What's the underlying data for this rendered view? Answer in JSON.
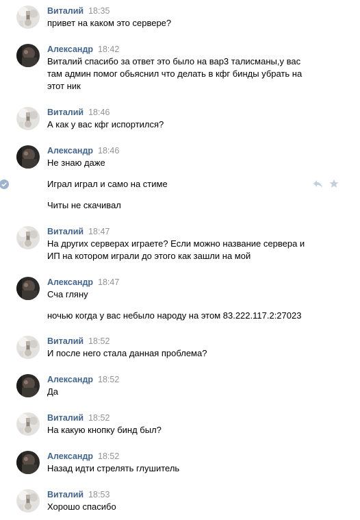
{
  "chat": {
    "messages": [
      {
        "author": "Виталий",
        "time": "18:35",
        "avatar": "vitaly-avatar",
        "lines": [
          "привет на каком это сервере?"
        ]
      },
      {
        "author": "Александр",
        "time": "18:42",
        "avatar": "alexander-avatar",
        "lines": [
          "Виталий спасибо за ответ это было на вар3 талисманы,у вас",
          "там админ помог обьяснил что делать в кфг бинды убрать на",
          "этот ник"
        ]
      },
      {
        "author": "Виталий",
        "time": "18:46",
        "avatar": "vitaly-avatar",
        "lines": [
          "А как у вас кфг испортился?"
        ]
      },
      {
        "author": "Александр",
        "time": "18:46",
        "avatar": "alexander-avatar",
        "lines": [
          "Не знаю даже",
          "Играл играл и само на стиме",
          "Читы не скачивал"
        ]
      },
      {
        "author": "Виталий",
        "time": "18:47",
        "avatar": "vitaly-avatar",
        "lines": [
          "На других серверах играете? Если можно название сервера и",
          "ИП на котором играли до этого как зашли на мой"
        ]
      },
      {
        "author": "Александр",
        "time": "18:47",
        "avatar": "alexander-avatar",
        "lines": [
          "Сча гляну",
          "ночью когда у вас небыло народу на этом 83.222.117.2:27023"
        ]
      },
      {
        "author": "Виталий",
        "time": "18:52",
        "avatar": "vitaly-avatar",
        "lines": [
          "И после него стала данная проблема?"
        ]
      },
      {
        "author": "Александр",
        "time": "18:52",
        "avatar": "alexander-avatar",
        "lines": [
          "Да"
        ]
      },
      {
        "author": "Виталий",
        "time": "18:52",
        "avatar": "vitaly-avatar",
        "lines": [
          "На какую кнопку бинд был?"
        ]
      },
      {
        "author": "Александр",
        "time": "18:52",
        "avatar": "alexander-avatar",
        "lines": [
          "Назад идти стрелять глушитель"
        ]
      },
      {
        "author": "Виталий",
        "time": "18:53",
        "avatar": "vitaly-avatar",
        "lines": [
          "Хорошо спасибо"
        ]
      }
    ],
    "hover_actions": {
      "selected_icon": "check-circle-icon",
      "reply_icon": "reply-icon",
      "favorite_icon": "star-icon"
    }
  },
  "colors": {
    "author": "#42648b",
    "time": "#939393",
    "text": "#000000",
    "selected": "#9fb4cc",
    "action_icon": "#c5d0db"
  }
}
